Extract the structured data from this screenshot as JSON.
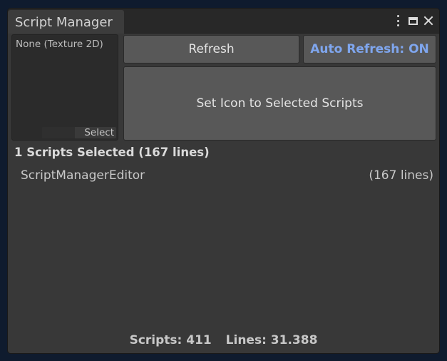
{
  "window": {
    "tab_title": "Script Manager"
  },
  "texture_field": {
    "value": "None (Texture 2D)",
    "select_label": "Select"
  },
  "buttons": {
    "refresh": "Refresh",
    "auto_refresh": "Auto Refresh: ON",
    "set_icon": "Set Icon to Selected Scripts"
  },
  "selection": {
    "title": "1 Scripts Selected (167 lines)",
    "items": [
      {
        "name": "ScriptManagerEditor",
        "lines": "(167 lines)"
      }
    ]
  },
  "footer": {
    "scripts": "Scripts: 411",
    "lines": "Lines: 31.388"
  },
  "colors": {
    "accent": "#7fa6ee",
    "panel": "#383838",
    "button": "#585858"
  },
  "icons": [
    "kebab-menu-icon",
    "maximize-icon",
    "close-icon"
  ]
}
